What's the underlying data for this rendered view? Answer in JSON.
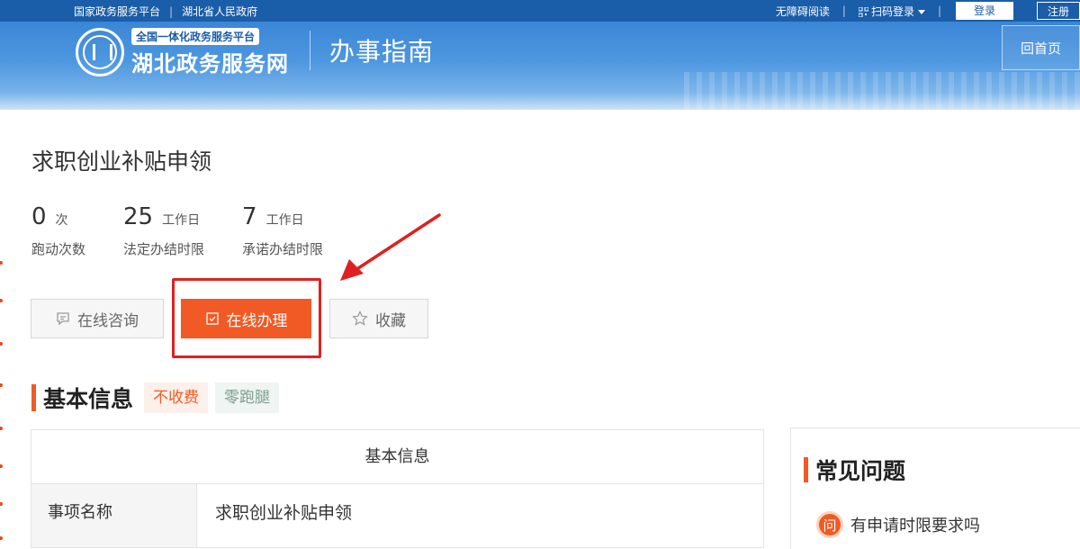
{
  "topbar": {
    "left_links": [
      "国家政务服务平台",
      "湖北省人民政府"
    ],
    "accessibility": "无障碍阅读",
    "login_method": "扫码登录",
    "login_button": "登录",
    "register_button": "注册"
  },
  "header": {
    "platform_badge": "全国一体化政务服务平台",
    "site_name": "湖北政务服务网",
    "section_title": "办事指南",
    "home_button": "回首页"
  },
  "item": {
    "title": "求职创业补贴申领",
    "stats": [
      {
        "value": "0",
        "unit": "次",
        "label": "跑动次数"
      },
      {
        "value": "25",
        "unit": "工作日",
        "label": "法定办结时限"
      },
      {
        "value": "7",
        "unit": "工作日",
        "label": "承诺办结时限"
      }
    ]
  },
  "actions": {
    "consult": "在线咨询",
    "handle": "在线办理",
    "favorite": "收藏"
  },
  "basic_info": {
    "section_title": "基本信息",
    "tags": [
      "不收费",
      "零跑腿"
    ],
    "table_header": "基本信息",
    "rows": [
      {
        "key": "事项名称",
        "value": "求职创业补贴申领"
      }
    ]
  },
  "faq": {
    "title": "常见问题",
    "icon_text": "问",
    "items": [
      "有申请时限要求吗"
    ]
  },
  "colors": {
    "primary_blue": "#1a5da8",
    "accent_orange": "#f15a24",
    "annotation_red": "#e02020"
  }
}
